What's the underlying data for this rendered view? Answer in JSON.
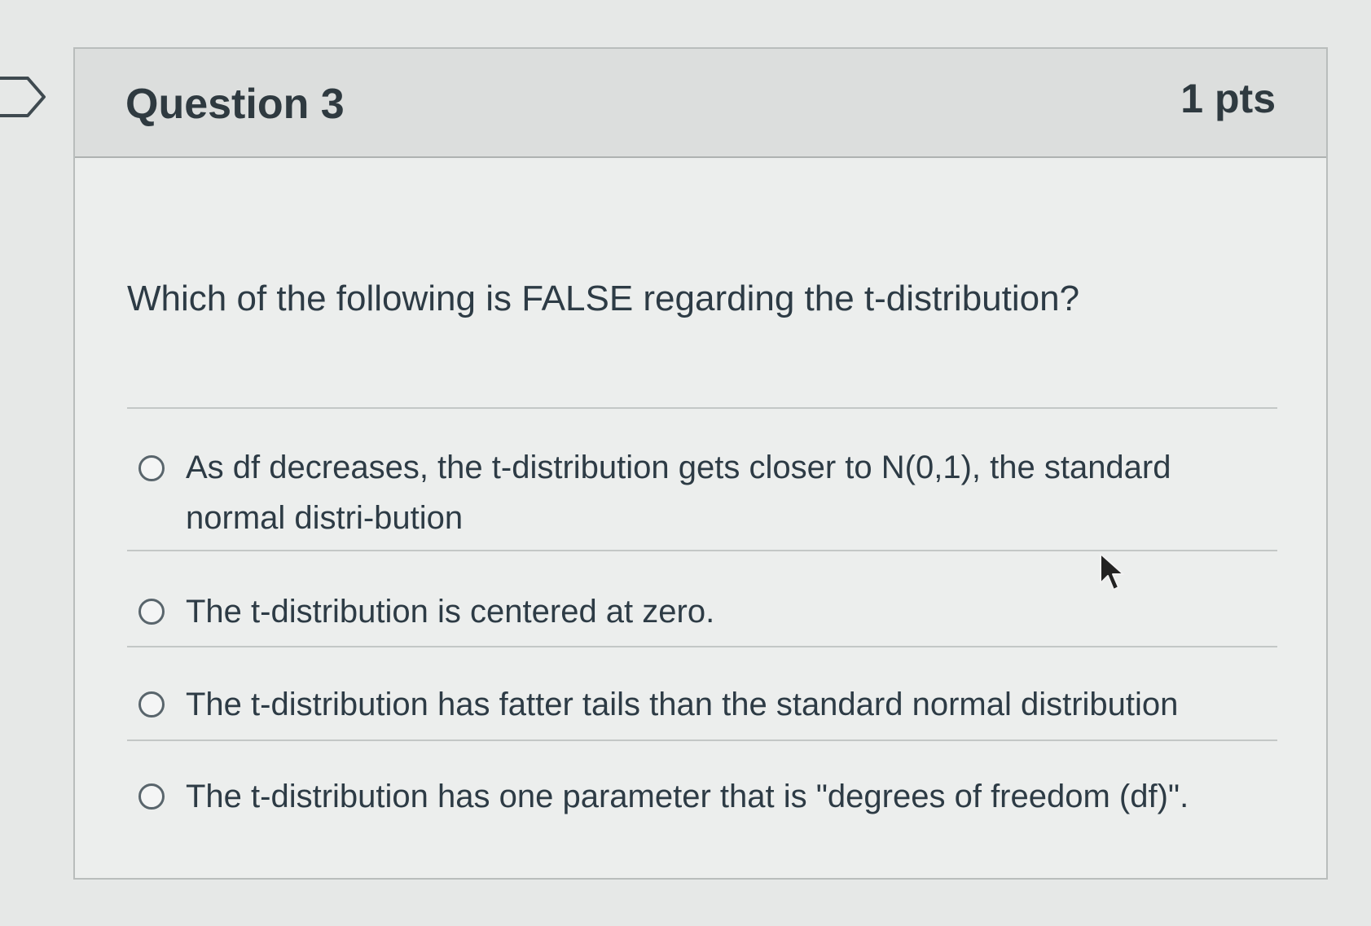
{
  "question": {
    "title": "Question 3",
    "points": "1 pts",
    "text": "Which of the following is FALSE regarding the t-distribution?"
  },
  "answers": [
    {
      "label": "As df decreases, the t-distribution gets closer to N(0,1), the standard normal distri-bution",
      "selected": false
    },
    {
      "label": "The t-distribution is centered at zero.",
      "selected": false
    },
    {
      "label": "The t-distribution has fatter tails than the standard normal distribution",
      "selected": false
    },
    {
      "label": "The t-distribution has one parameter that is \"degrees of freedom (df)\".",
      "selected": false
    }
  ],
  "icons": {
    "flag": "flag-outline-icon",
    "cursor": "mouse-pointer-icon"
  },
  "colors": {
    "text": "#2d3b45",
    "header_background": "#dcdedd",
    "border": "#b9bdbc"
  }
}
